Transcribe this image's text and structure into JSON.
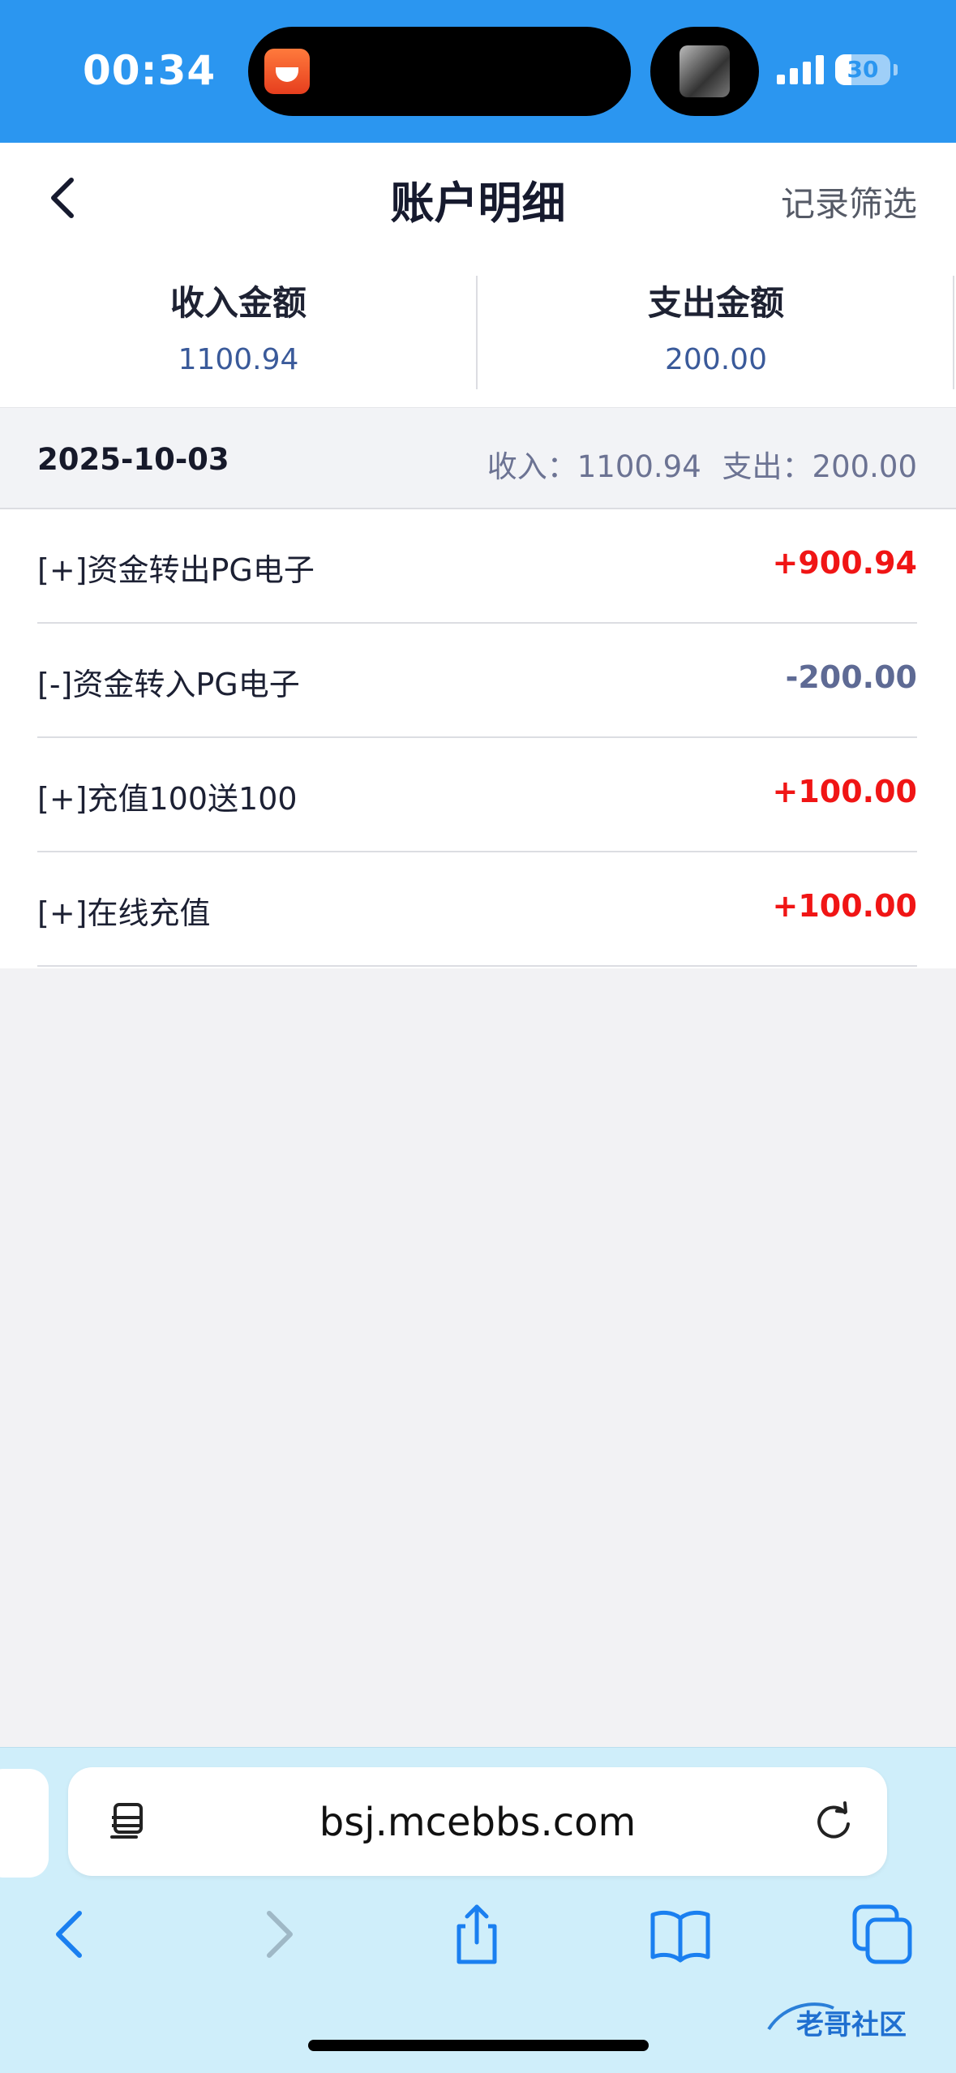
{
  "status_bar": {
    "time": "00:34",
    "battery": "30",
    "battery_level": 0.3,
    "island_app_icon": "tomato-app-icon",
    "island_media_icon": "media-thumbnail-icon"
  },
  "header": {
    "title": "账户明细",
    "filter_label": "记录筛选",
    "back_icon": "chevron-left-icon"
  },
  "summary": {
    "income_label": "收入金额",
    "income_value": "1100.94",
    "expense_label": "支出金额",
    "expense_value": "200.00"
  },
  "day_group": {
    "date": "2025-10-03",
    "income_summary": "收入：1100.94",
    "expense_summary": "支出：200.00"
  },
  "records": [
    {
      "name": "[+]资金转出PG电子",
      "amount": "+900.94",
      "type": "income"
    },
    {
      "name": "[-]资金转入PG电子",
      "amount": "-200.00",
      "type": "expense"
    },
    {
      "name": "[+]充值100送100",
      "amount": "+100.00",
      "type": "income"
    },
    {
      "name": "[+]在线充值",
      "amount": "+100.00",
      "type": "income"
    }
  ],
  "browser": {
    "url": "bsj.mcebbs.com",
    "icons": [
      "reader-icon",
      "reload-icon",
      "back-icon",
      "forward-icon",
      "share-icon",
      "bookmarks-icon",
      "tabs-icon"
    ]
  },
  "colors": {
    "status_bar": "#2b96f0",
    "income": "#f01515",
    "expense": "#5e6a94",
    "browser_bar": "#cfeefa",
    "icon_blue": "#1a7ff0"
  },
  "watermark": "老哥社区"
}
